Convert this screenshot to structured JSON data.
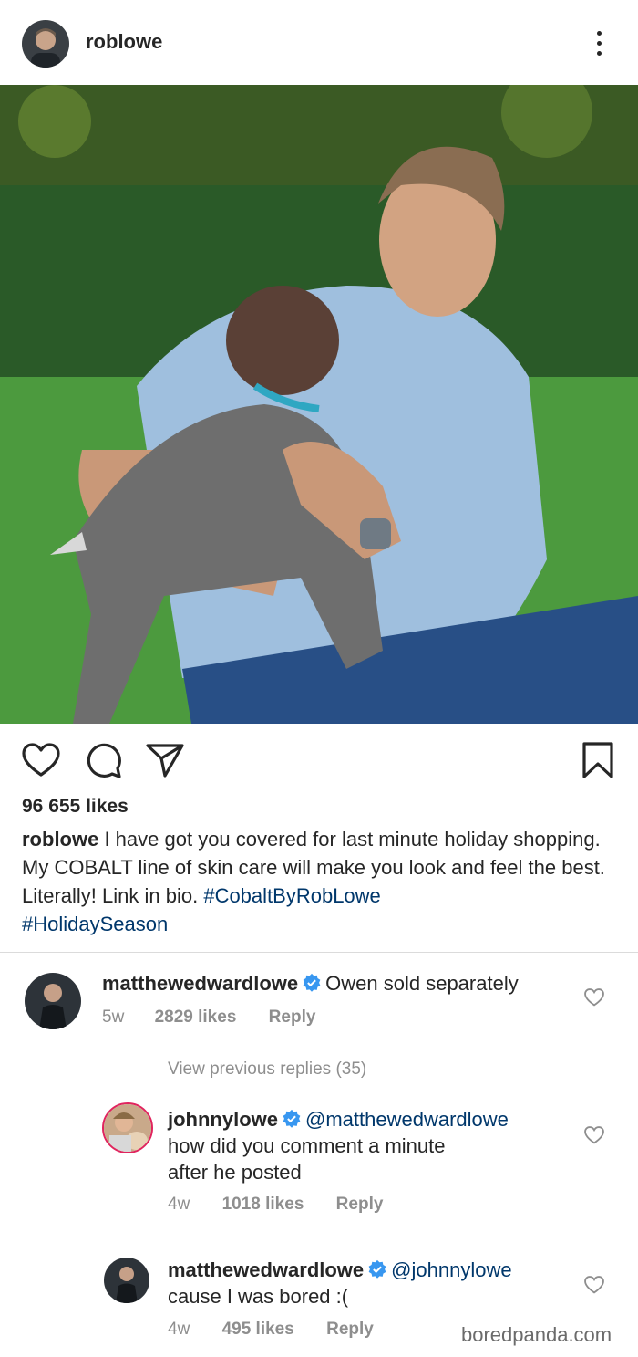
{
  "post": {
    "username": "roblowe",
    "likes": "96 655 likes",
    "caption_user": "roblowe",
    "caption_text": " I have got you covered for last minute holiday shopping. My COBALT line of skin care will make you look and feel the best. Literally! Link in bio. ",
    "hashtags": [
      "#CobaltByRobLowe",
      "#HolidaySeason"
    ]
  },
  "comments": [
    {
      "user": "matthewedwardlowe",
      "mention": "",
      "text": "Owen sold separately",
      "age": "5w",
      "likes": "2829 likes",
      "reply": "Reply"
    }
  ],
  "view_previous": "View previous replies (35)",
  "replies": [
    {
      "user": "johnnylowe",
      "mention": "@matthewedwardlowe",
      "text": "how did you comment a minute after he posted",
      "age": "4w",
      "likes": "1018 likes",
      "reply": "Reply"
    },
    {
      "user": "matthewedwardlowe",
      "mention": "@johnnylowe",
      "text": "cause I was bored :(",
      "age": "4w",
      "likes": "495 likes",
      "reply": "Reply"
    }
  ],
  "watermark": "boredpanda.com",
  "icons": {
    "more": "more-vertical-icon",
    "like": "heart-icon",
    "comment": "comment-bubble-icon",
    "share": "paper-plane-icon",
    "save": "bookmark-icon",
    "verified": "verified-badge-icon"
  },
  "colors": {
    "text": "#262626",
    "secondary": "#8e8e8e",
    "link": "#00376b",
    "verified": "#3897f0"
  }
}
